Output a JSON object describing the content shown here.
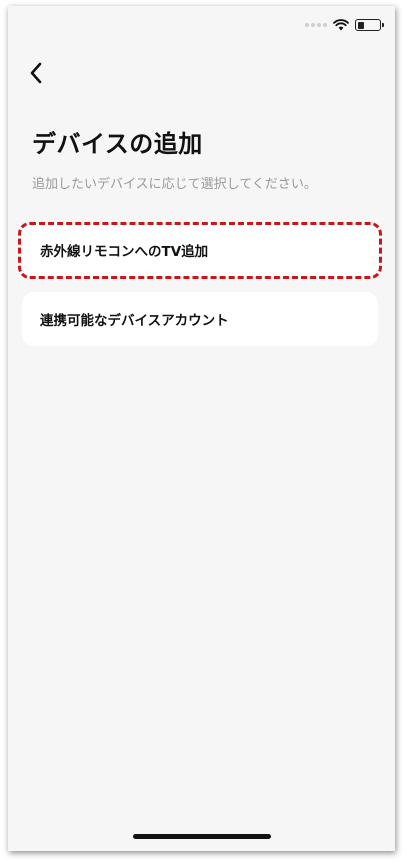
{
  "status_bar": {
    "icons": [
      "signal-dots-icon",
      "wifi-icon",
      "battery-icon"
    ],
    "battery_level": 0.3
  },
  "header": {
    "back_icon": "chevron-left-icon",
    "title": "デバイスの追加",
    "subtitle": "追加したいデバイスに応じて選択してください。"
  },
  "options": [
    {
      "label": "赤外線リモコンへのTV追加",
      "highlighted": true
    },
    {
      "label": "連携可能なデバイスアカウント",
      "highlighted": false
    }
  ],
  "colors": {
    "background": "#f6f6f6",
    "card": "#ffffff",
    "highlight": "#c8161d",
    "title": "#111111",
    "subtitle": "#9a9a9a"
  }
}
